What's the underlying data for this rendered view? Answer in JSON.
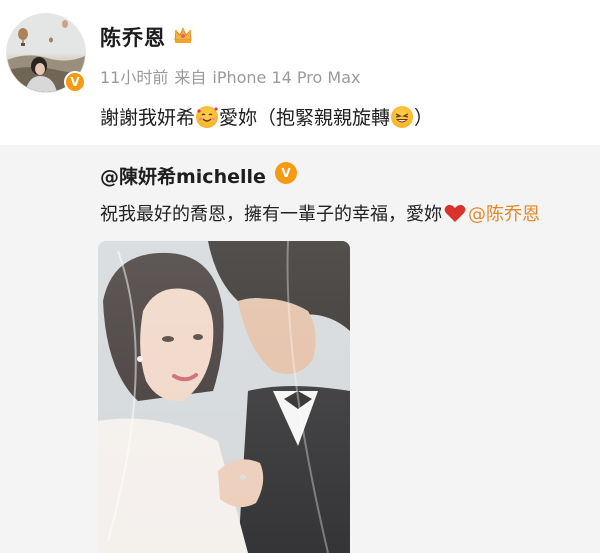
{
  "post": {
    "username": "陈乔恩",
    "time": "11小时前",
    "source_prefix": "来自",
    "source_device": "iPhone 14 Pro Max",
    "text_part1": "謝謝我妍希",
    "text_part2": "愛妳（抱緊親親旋轉",
    "text_part3": "）"
  },
  "repost": {
    "author": "@陳妍希michelle",
    "text": "祝我最好的喬恩，擁有一輩子的幸福，愛妳",
    "mention": "@陈乔恩"
  },
  "colors": {
    "verified_badge": "#f59a12",
    "mention": "#e08a2c",
    "repost_background": "#f4f4f4"
  },
  "icons": [
    "verified-icon",
    "crown-icon",
    "smiling-face-with-hearts-emoji",
    "laughing-emoji",
    "red-heart-icon"
  ]
}
